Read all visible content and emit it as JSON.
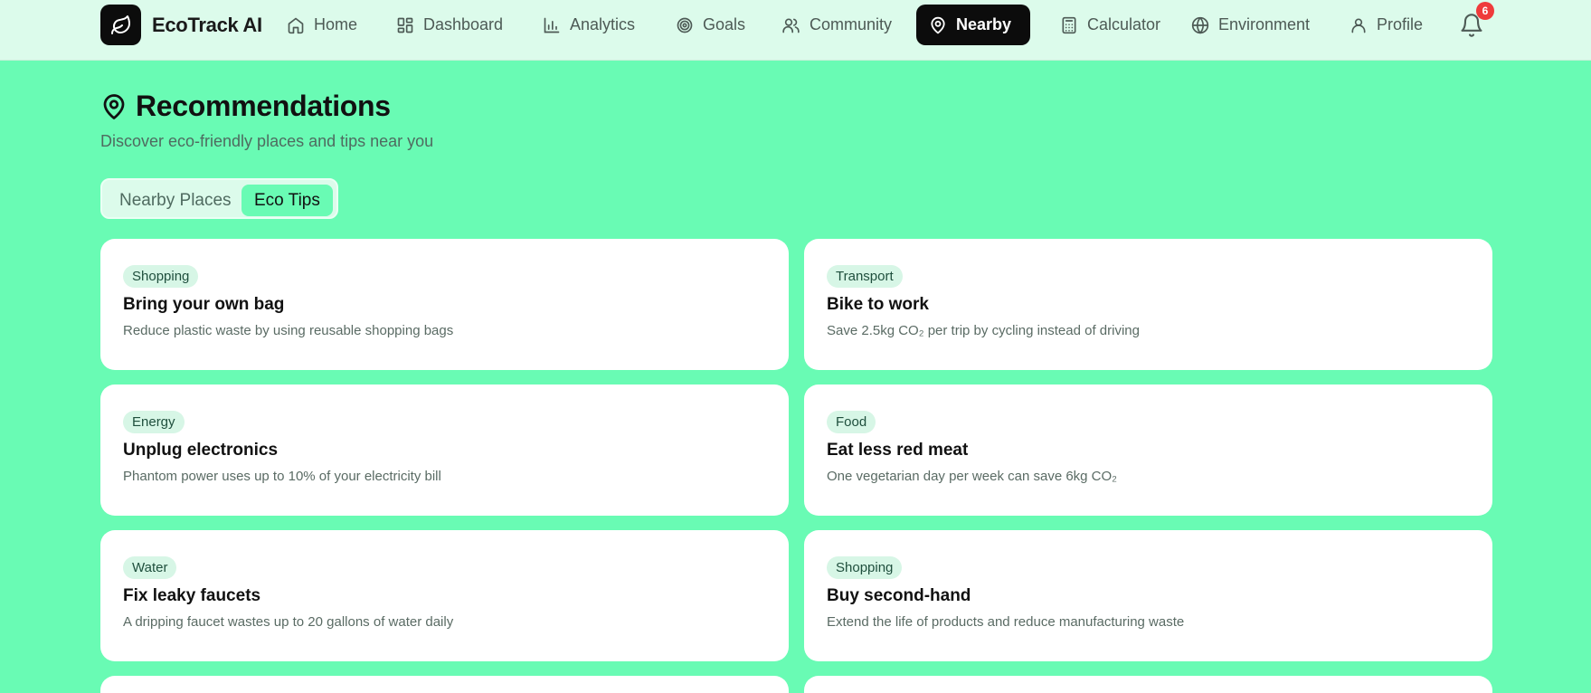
{
  "app": {
    "name": "EcoTrack AI"
  },
  "nav": {
    "items": [
      {
        "label": "Home",
        "icon": "home-icon"
      },
      {
        "label": "Dashboard",
        "icon": "dashboard-icon"
      },
      {
        "label": "Analytics",
        "icon": "analytics-icon"
      },
      {
        "label": "Goals",
        "icon": "target-icon"
      },
      {
        "label": "Community",
        "icon": "users-icon"
      },
      {
        "label": "Nearby",
        "icon": "map-pin-icon",
        "active": true
      },
      {
        "label": "Calculator",
        "icon": "calculator-icon"
      },
      {
        "label": "Environment",
        "icon": "globe-icon"
      },
      {
        "label": "Profile",
        "icon": "user-icon"
      }
    ],
    "notifications": {
      "count": "6"
    }
  },
  "header": {
    "title": "Recommendations",
    "subtitle": "Discover eco-friendly places and tips near you"
  },
  "tabs": {
    "items": [
      {
        "label": "Nearby Places"
      },
      {
        "label": "Eco Tips",
        "active": true
      }
    ]
  },
  "tips": [
    {
      "category": "Shopping",
      "title": "Bring your own bag",
      "description": "Reduce plastic waste by using reusable shopping bags"
    },
    {
      "category": "Transport",
      "title": "Bike to work",
      "description": "Save 2.5kg CO₂ per trip by cycling instead of driving"
    },
    {
      "category": "Energy",
      "title": "Unplug electronics",
      "description": "Phantom power uses up to 10% of your electricity bill"
    },
    {
      "category": "Food",
      "title": "Eat less red meat",
      "description": "One vegetarian day per week can save 6kg CO₂"
    },
    {
      "category": "Water",
      "title": "Fix leaky faucets",
      "description": "A dripping faucet wastes up to 20 gallons of water daily"
    },
    {
      "category": "Shopping",
      "title": "Buy second-hand",
      "description": "Extend the life of products and reduce manufacturing waste"
    }
  ],
  "colors": {
    "background": "#69fbb4",
    "navbar": "#dcfbeb",
    "active_nav": "#0c0c0c",
    "badge": "#d7f6e6",
    "notification": "#ef3b3b"
  }
}
